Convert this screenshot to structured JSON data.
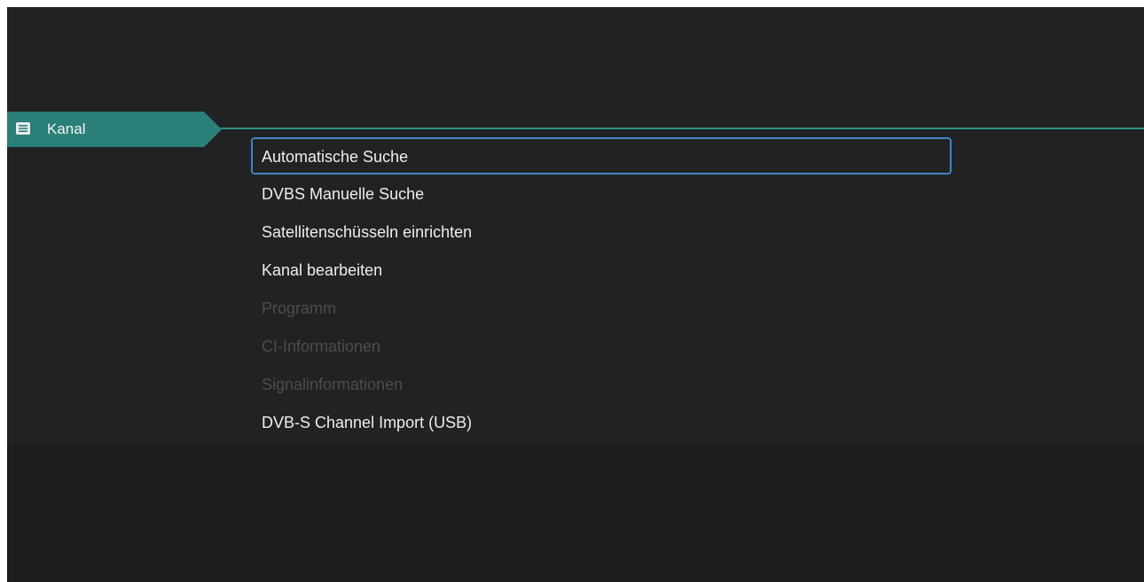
{
  "colors": {
    "background": "#1d1e1f",
    "accent_teal": "#2a7f78",
    "focus_border": "#3f86c6",
    "text_enabled": "#eceeef",
    "text_disabled": "#4b4d4f"
  },
  "category": {
    "icon": "list-icon",
    "label": "Kanal"
  },
  "menu": {
    "items": [
      {
        "label": "Automatische Suche",
        "state": "selected"
      },
      {
        "label": "DVBS Manuelle Suche",
        "state": "enabled"
      },
      {
        "label": "Satellitenschüsseln einrichten",
        "state": "enabled"
      },
      {
        "label": "Kanal bearbeiten",
        "state": "enabled"
      },
      {
        "label": "Programm",
        "state": "disabled"
      },
      {
        "label": "CI-Informationen",
        "state": "disabled"
      },
      {
        "label": "Signalinformationen",
        "state": "disabled"
      },
      {
        "label": "DVB-S Channel Import (USB)",
        "state": "enabled"
      }
    ]
  }
}
